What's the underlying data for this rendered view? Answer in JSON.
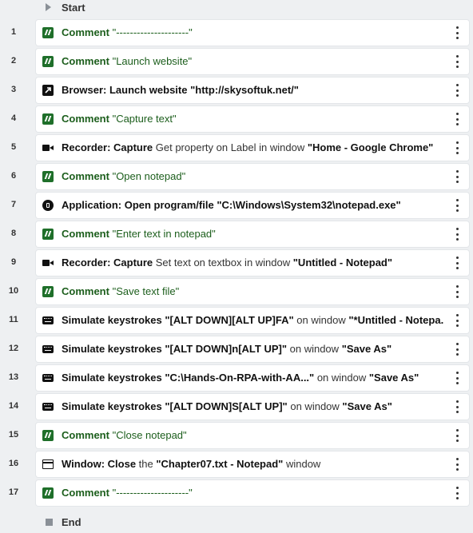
{
  "start_label": "Start",
  "end_label": "End",
  "rows": [
    {
      "num": "1",
      "icon": "comment-icon",
      "kind": "comment",
      "label": "Comment",
      "value": "\"---------------------\""
    },
    {
      "num": "2",
      "icon": "comment-icon",
      "kind": "comment",
      "label": "Comment",
      "value": "\"Launch website\""
    },
    {
      "num": "3",
      "icon": "browser-icon",
      "kind": "action",
      "label": "Browser: Launch website",
      "plain": "",
      "qvalue": "\"http://skysoftuk.net/\"",
      "tail": ""
    },
    {
      "num": "4",
      "icon": "comment-icon",
      "kind": "comment",
      "label": "Comment",
      "value": "\"Capture text\""
    },
    {
      "num": "5",
      "icon": "recorder-icon",
      "kind": "action",
      "label": "Recorder: Capture",
      "plain": "Get property on Label in window",
      "qvalue": "\"Home - Google Chrome\"",
      "tail": ""
    },
    {
      "num": "6",
      "icon": "comment-icon",
      "kind": "comment",
      "label": "Comment",
      "value": "\"Open notepad\""
    },
    {
      "num": "7",
      "icon": "application-icon",
      "kind": "action",
      "label": "Application: Open program/file",
      "plain": "",
      "qvalue": "\"C:\\Windows\\System32\\notepad.exe\"",
      "tail": ""
    },
    {
      "num": "8",
      "icon": "comment-icon",
      "kind": "comment",
      "label": "Comment",
      "value": "\"Enter text in notepad\""
    },
    {
      "num": "9",
      "icon": "recorder-icon",
      "kind": "action",
      "label": "Recorder: Capture",
      "plain": "Set text on textbox in window",
      "qvalue": "\"Untitled - Notepad\"",
      "tail": ""
    },
    {
      "num": "10",
      "icon": "comment-icon",
      "kind": "comment",
      "label": "Comment",
      "value": "\"Save text file\""
    },
    {
      "num": "11",
      "icon": "keystrokes-icon",
      "kind": "keys",
      "label": "Simulate keystrokes",
      "qvalue": "\"[ALT DOWN][ALT UP]FA\"",
      "plain": "on window",
      "qvalue2": "\"*Untitled - Notepa..."
    },
    {
      "num": "12",
      "icon": "keystrokes-icon",
      "kind": "keys",
      "label": "Simulate keystrokes",
      "qvalue": "\"[ALT DOWN]n[ALT UP]\"",
      "plain": "on window",
      "qvalue2": "\"Save As\""
    },
    {
      "num": "13",
      "icon": "keystrokes-icon",
      "kind": "keys",
      "label": "Simulate keystrokes",
      "qvalue": "\"C:\\Hands-On-RPA-with-AA...\"",
      "plain": "on window",
      "qvalue2": "\"Save As\""
    },
    {
      "num": "14",
      "icon": "keystrokes-icon",
      "kind": "keys",
      "label": "Simulate keystrokes",
      "qvalue": "\"[ALT DOWN]S[ALT UP]\"",
      "plain": "on window",
      "qvalue2": "\"Save As\""
    },
    {
      "num": "15",
      "icon": "comment-icon",
      "kind": "comment",
      "label": "Comment",
      "value": "\"Close notepad\""
    },
    {
      "num": "16",
      "icon": "window-icon",
      "kind": "window",
      "label": "Window: Close",
      "plain": "the",
      "qvalue": "\"Chapter07.txt - Notepad\"",
      "tail": "window"
    },
    {
      "num": "17",
      "icon": "comment-icon",
      "kind": "comment",
      "label": "Comment",
      "value": "\"---------------------\""
    }
  ]
}
